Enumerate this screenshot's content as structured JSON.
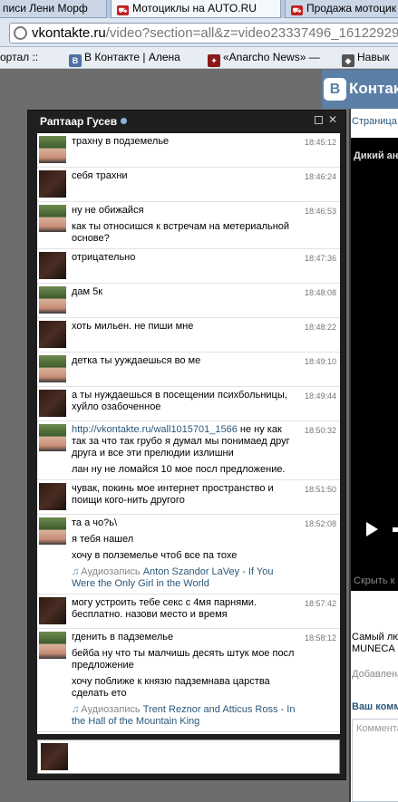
{
  "browser": {
    "tabs": [
      {
        "label": "писи Лени Морф"
      },
      {
        "label": "Мотоциклы на AUTO.RU"
      },
      {
        "label": "Продажа мотоцик"
      }
    ],
    "url_host": "vkontakte.ru",
    "url_path": "/video?section=all&z=video23337496_16122929",
    "bookmarks": [
      {
        "label": "ортал ::",
        "icon": "page-icon"
      },
      {
        "label": "В Контакте | Алена",
        "icon": "vk-icon"
      },
      {
        "label": "«Anarcho News» —",
        "icon": "moto-icon"
      },
      {
        "label": "Навык",
        "icon": "site-icon"
      }
    ]
  },
  "page": {
    "logo_text": "Контакте",
    "logo_letter": "B",
    "nav_link": "Страница",
    "video_title": "Дикий ан",
    "hide_link": "Скрыть к",
    "description": "Самый лю\nMUNECA B",
    "added_label": "Добавлена",
    "comment_heading": "Ваш комм",
    "comment_placeholder": "Коммента"
  },
  "chat": {
    "contact_name": "Раптаар Гусев",
    "messages": [
      {
        "time": "18:45:12",
        "avatar": "a",
        "lines": [
          "трахну в подземелье"
        ]
      },
      {
        "time": "18:46:24",
        "avatar": "b",
        "lines": [
          "себя трахни"
        ]
      },
      {
        "time": "18:46:53",
        "avatar": "a",
        "lines": [
          "ну не обижайся",
          "как ты относишся к встречам на метериальной основе?"
        ]
      },
      {
        "time": "18:47:36",
        "avatar": "b",
        "lines": [
          "отрицательно"
        ]
      },
      {
        "time": "18:48:08",
        "avatar": "a",
        "lines": [
          "дам 5к"
        ]
      },
      {
        "time": "18:48:22",
        "avatar": "b",
        "lines": [
          "хоть мильен. не пиши мне"
        ]
      },
      {
        "time": "18:49:10",
        "avatar": "a",
        "lines": [
          "детка ты ууждаешься во ме"
        ]
      },
      {
        "time": "18:49:44",
        "avatar": "b",
        "lines": [
          "а ты нуждаешься в посещении психбольницы, хуйло озабоченное"
        ]
      },
      {
        "time": "18:50:32",
        "avatar": "a",
        "link": "http://vkontakte.ru/wall1015701_1566",
        "lines": [
          " не ну как так за что так грубо я думал мы понимаед друг друга и все эти прелюдии излишни",
          "лан ну не ломайся 10 мое посл предложение."
        ]
      },
      {
        "time": "18:51:50",
        "avatar": "b",
        "lines": [
          "чувак, покинь мое интернет пространство и поищи кого-нить другого"
        ]
      },
      {
        "time": "18:52:08",
        "avatar": "a",
        "lines": [
          "та а чо?ь\\",
          "я тебя нашел",
          "хочу в полземелье чтоб все па тохе"
        ],
        "audio": {
          "label": "Аудиозапись",
          "track": "Anton Szandor LaVey - If You Were the Only Girl in the World"
        }
      },
      {
        "time": "18:57:42",
        "avatar": "b",
        "lines": [
          "могу устроить тебе секс с 4мя парнями. бесплатно. назови место и время"
        ]
      },
      {
        "time": "18:58:12",
        "avatar": "a",
        "lines": [
          "гденить в падземелье",
          "бейба ну что ты малчишь десять штук мое посл предложение",
          "хочу поближе к князю падземнава царства сделать ето"
        ],
        "audio": {
          "label": "Аудиозапись",
          "track": "Trent Reznor and Atticus Ross - In the Hall of the Mountain King"
        }
      }
    ]
  }
}
